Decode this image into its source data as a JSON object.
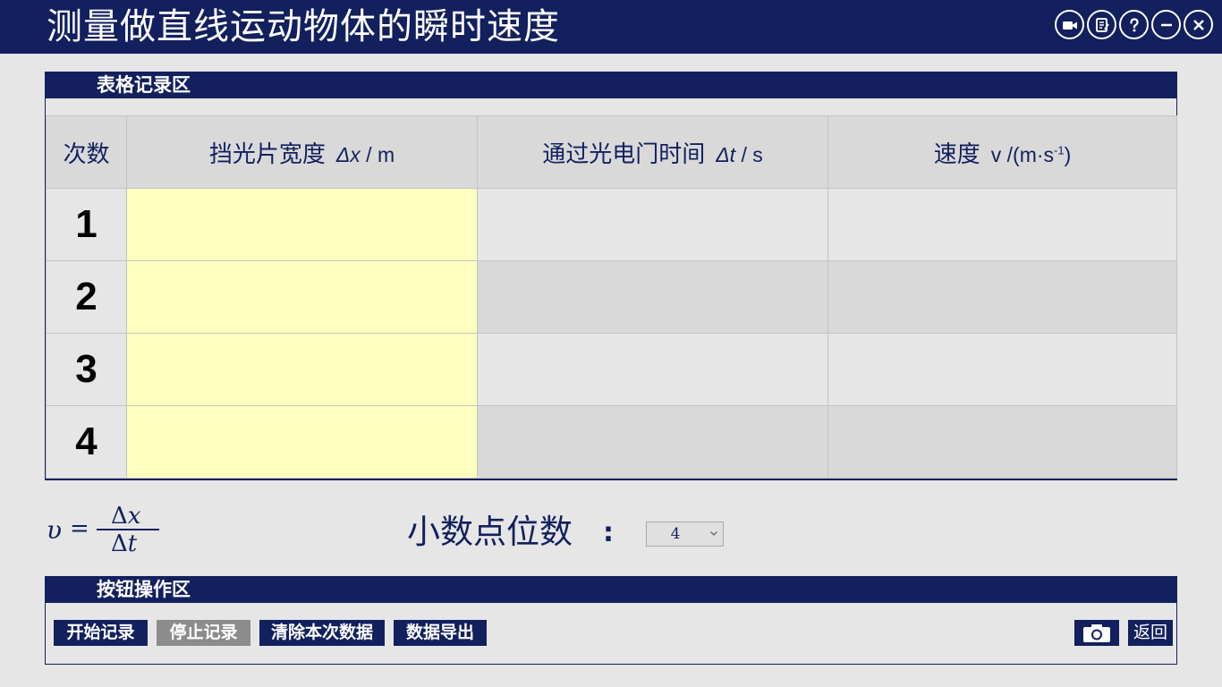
{
  "window": {
    "title": "测量做直线运动物体的瞬时速度",
    "buttons": [
      "video-icon",
      "notes-icon",
      "help-icon",
      "minimize-icon",
      "close-icon"
    ]
  },
  "table_section": {
    "header": "表格记录区",
    "columns": [
      {
        "label": "次数"
      },
      {
        "label": "挡光片宽度",
        "unit_symbol": "Δx",
        "unit_rest": " / m"
      },
      {
        "label": "通过光电门时间",
        "unit_symbol": "Δt",
        "unit_rest": " / s"
      },
      {
        "label": "速度",
        "unit_symbol": "v",
        "unit_rest": " /(m·s",
        "unit_sup": "-1",
        "unit_end": ")"
      }
    ],
    "rows": [
      {
        "index": "1",
        "width": "",
        "time": "",
        "speed": ""
      },
      {
        "index": "2",
        "width": "",
        "time": "",
        "speed": ""
      },
      {
        "index": "3",
        "width": "",
        "time": "",
        "speed": ""
      },
      {
        "index": "4",
        "width": "",
        "time": "",
        "speed": ""
      }
    ]
  },
  "formula": {
    "lhs": "υ",
    "eq": "=",
    "num_delta": "Δ",
    "num_var": "x",
    "den_delta": "Δ",
    "den_var": "t"
  },
  "decimal": {
    "label": "小数点位数",
    "colon": ":",
    "selected": "4"
  },
  "button_section": {
    "header": "按钮操作区",
    "start": "开始记录",
    "stop": "停止记录",
    "clear": "清除本次数据",
    "export": "数据导出",
    "camera_icon": "camera-icon",
    "back": "返回"
  },
  "colors": {
    "navy": "#13205e",
    "input_cell": "#ffffc0",
    "disabled_button": "#8c8c8c"
  }
}
